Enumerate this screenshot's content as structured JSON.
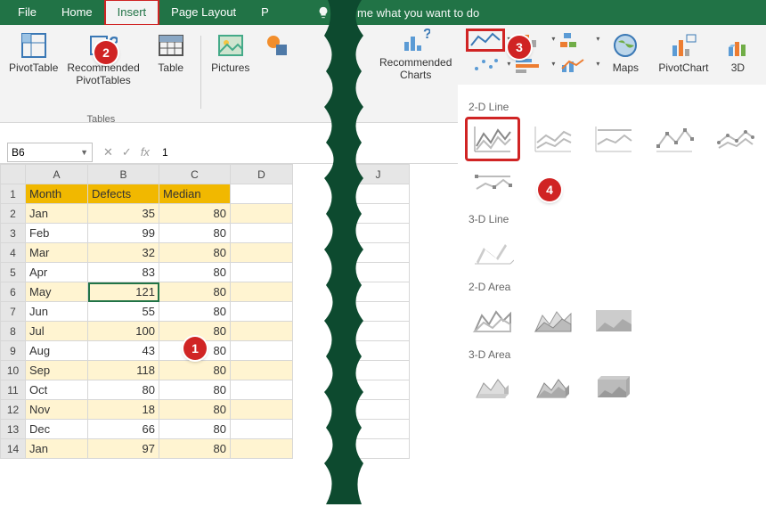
{
  "tabs": {
    "file": "File",
    "home": "Home",
    "insert": "Insert",
    "layout": "Page Layout",
    "cut": "P"
  },
  "tell": "Tell me what you want to do",
  "ribbon_left": {
    "pivot": "PivotTable",
    "recpivot": "Recommended\nPivotTables",
    "table": "Table",
    "pictures": "Pictures",
    "group1": "Tables"
  },
  "ribbon_right": {
    "recchart": "Recommended\nCharts",
    "maps": "Maps",
    "pivotchart": "PivotChart",
    "threeD": "3D"
  },
  "namebox": "B6",
  "fx_value": "1",
  "grid": {
    "cols": [
      "A",
      "B",
      "C",
      "D",
      "J"
    ],
    "header": [
      "Month",
      "Defects",
      "Median"
    ],
    "rows": [
      {
        "n": 1
      },
      {
        "n": 2,
        "m": "Jan",
        "d": 35,
        "me": 80
      },
      {
        "n": 3,
        "m": "Feb",
        "d": 99,
        "me": 80
      },
      {
        "n": 4,
        "m": "Mar",
        "d": 32,
        "me": 80
      },
      {
        "n": 5,
        "m": "Apr",
        "d": 83,
        "me": 80
      },
      {
        "n": 6,
        "m": "May",
        "d": 121,
        "me": 80
      },
      {
        "n": 7,
        "m": "Jun",
        "d": 55,
        "me": 80
      },
      {
        "n": 8,
        "m": "Jul",
        "d": 100,
        "me": 80
      },
      {
        "n": 9,
        "m": "Aug",
        "d": 43,
        "me": 80
      },
      {
        "n": 10,
        "m": "Sep",
        "d": 118,
        "me": 80
      },
      {
        "n": 11,
        "m": "Oct",
        "d": 80,
        "me": 80
      },
      {
        "n": 12,
        "m": "Nov",
        "d": 18,
        "me": 80
      },
      {
        "n": 13,
        "m": "Dec",
        "d": 66,
        "me": 80
      },
      {
        "n": 14,
        "m": "Jan",
        "d": 97,
        "me": 80
      }
    ]
  },
  "panel": {
    "s1": "2-D Line",
    "s2": "3-D Line",
    "s3": "2-D Area",
    "s4": "3-D Area"
  },
  "callouts": {
    "c1": "1",
    "c2": "2",
    "c3": "3",
    "c4": "4"
  }
}
